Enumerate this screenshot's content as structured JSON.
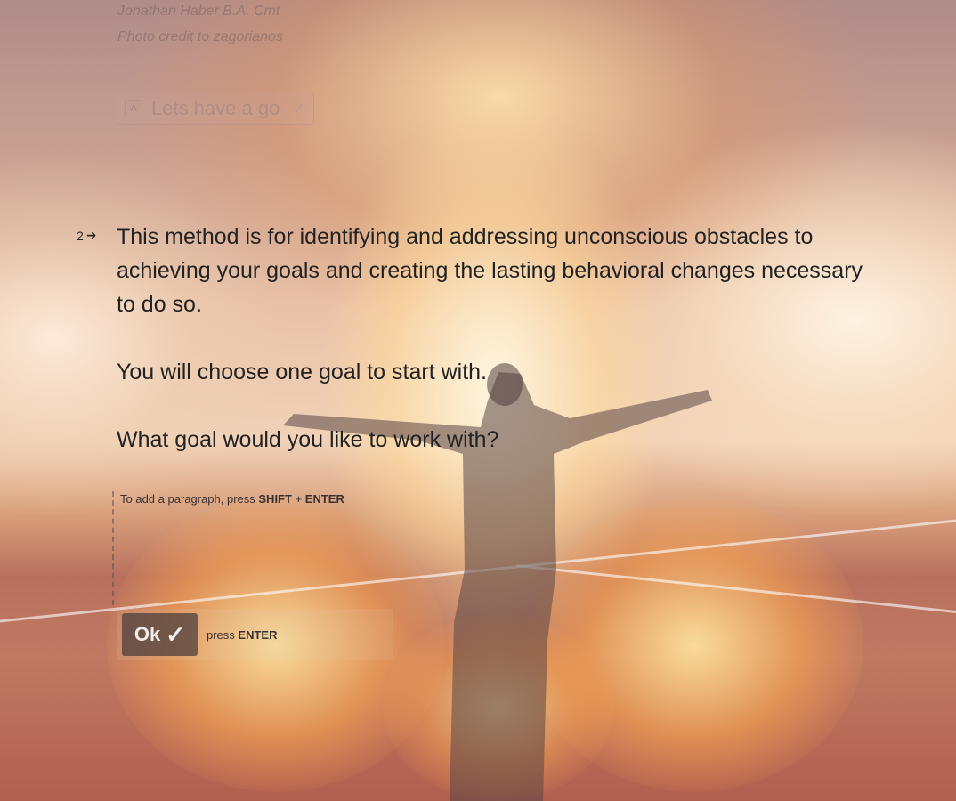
{
  "credits": {
    "author": "Jonathan Haber B.A. Cmt",
    "photo": "Photo credit to zagorianos"
  },
  "previous_choice": {
    "key": "A",
    "label": "Lets have a go",
    "check": "✓"
  },
  "question": {
    "number": "2",
    "arrow": "➜",
    "paragraphs": [
      "This method is for identifying and addressing unconscious obstacles to achieving your goals and creating the lasting behavioral changes necessary to do so.",
      "You will choose one goal to start with.",
      "What goal would you like to work with?"
    ]
  },
  "answer": {
    "hint_prefix": "To add a paragraph, press ",
    "hint_key1": "SHIFT",
    "hint_plus": " + ",
    "hint_key2": "ENTER"
  },
  "ok": {
    "label": "Ok",
    "tick": "✓",
    "press_prefix": "press ",
    "press_key": "ENTER"
  }
}
